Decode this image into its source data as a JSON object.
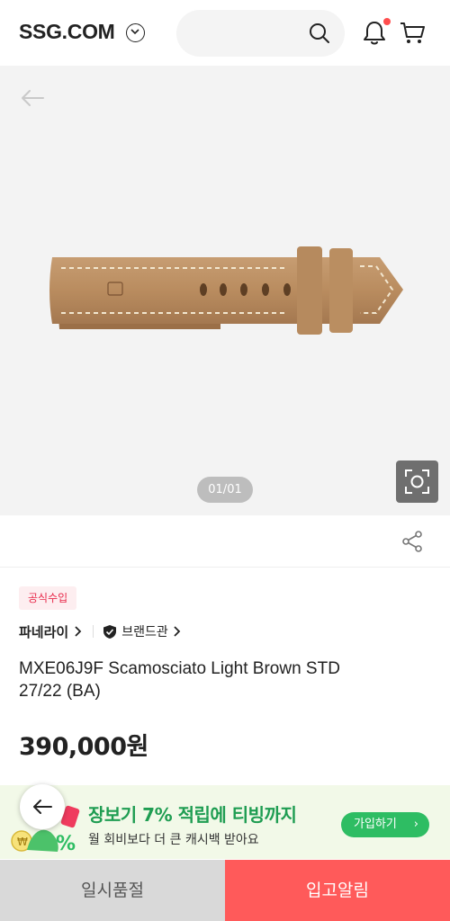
{
  "header": {
    "logo": "SSG.COM",
    "search_placeholder": ""
  },
  "gallery": {
    "counter": "01/01"
  },
  "product": {
    "badge": "공식수입",
    "brand": "파네라이",
    "brand_shop": "브랜드관",
    "title": "MXE06J9F Scamosciato Light Brown STD 27/22 (BA)",
    "price": "390,000원"
  },
  "promo": {
    "title": "장보기 7% 적립에 티빙까지",
    "subtitle": "월 회비보다 더 큰 캐시백 받아요",
    "button": "가입하기"
  },
  "actions": {
    "soldout": "일시품절",
    "notify": "입고알림"
  },
  "colors": {
    "accent_red": "#ff5a5a",
    "promo_green": "#2ebd63",
    "badge_red": "#e8294a"
  },
  "icons": [
    "chevron-down-circle-icon",
    "search-icon",
    "bell-icon",
    "cart-icon",
    "back-arrow-icon",
    "camera-lens-icon",
    "share-icon",
    "shield-check-icon"
  ]
}
